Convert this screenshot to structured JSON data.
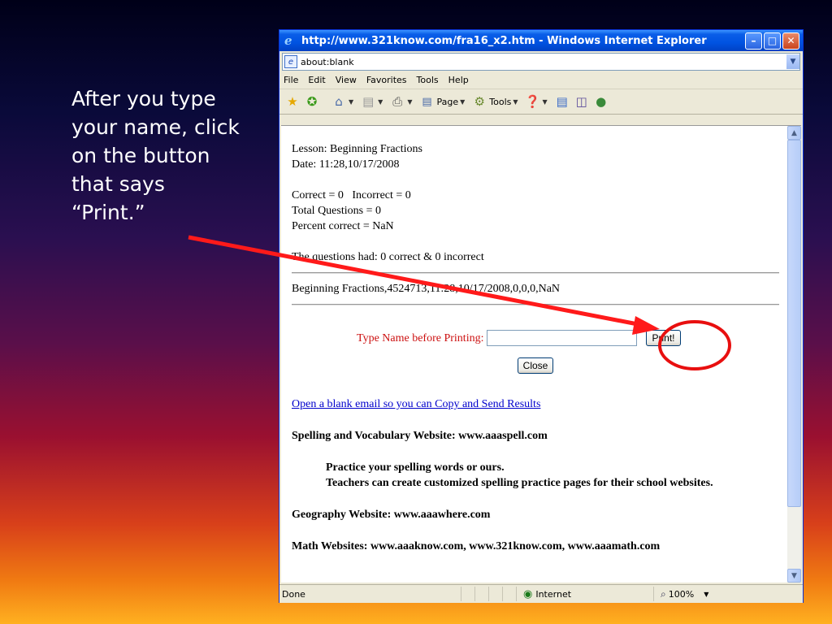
{
  "slide": {
    "instruction": "After you type\nyour name, click\non the button\nthat says\n“Print.”"
  },
  "window": {
    "title": "http://www.321know.com/fra16_x2.htm - Windows Internet Explorer",
    "address": "about:blank",
    "menu": [
      "File",
      "Edit",
      "View",
      "Favorites",
      "Tools",
      "Help"
    ],
    "toolbar": {
      "page_label": "Page",
      "tools_label": "Tools"
    }
  },
  "page": {
    "lesson": "Lesson: Beginning Fractions",
    "date": "Date: 11:28,10/17/2008",
    "correct_incorrect": "Correct = 0   Incorrect = 0",
    "total_questions": "Total Questions = 0",
    "percent_correct": "Percent correct = NaN",
    "questions_summary": "The questions had: 0 correct & 0 incorrect",
    "result_string": "Beginning Fractions,4524713,11:28,10/17/2008,0,0,0,NaN",
    "type_name_label": "Type Name before Printing:",
    "name_value": "",
    "print_label": "Print!",
    "close_label": "Close",
    "email_link": "Open a blank email so you can Copy and Send Results",
    "spelling_heading": "Spelling and Vocabulary Website: www.aaaspell.com",
    "spelling_line1": "Practice your spelling words or ours.",
    "spelling_line2": "Teachers can create customized spelling practice pages for their school websites.",
    "geography_heading": "Geography Website: www.aaawhere.com",
    "math_heading": "Math Websites: www.aaaknow.com, www.321know.com, www.aaamath.com"
  },
  "status": {
    "text": "Done",
    "zone": "Internet",
    "zoom": "100%"
  },
  "colors": {
    "arrow": "#ff1a1a",
    "label_red": "#cc1010",
    "link": "#0000cc"
  }
}
